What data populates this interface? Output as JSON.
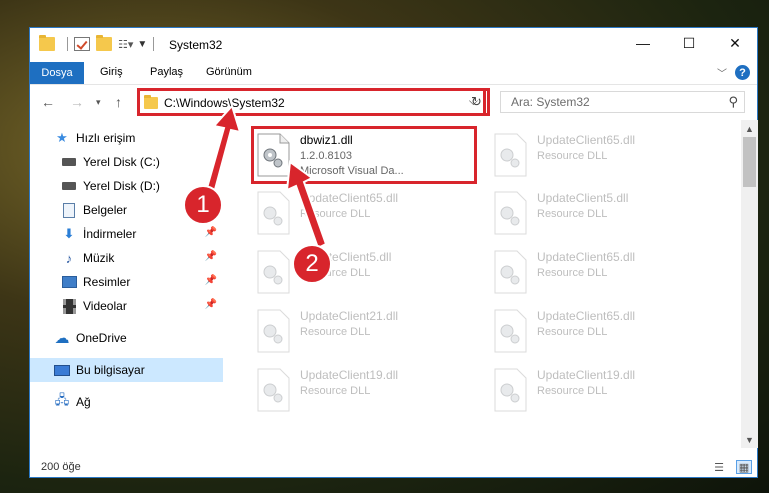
{
  "window": {
    "title": "System32",
    "minimize_icon": "minimize-icon",
    "maximize_icon": "maximize-icon",
    "close_icon": "close-icon"
  },
  "ribbon": {
    "tabs": [
      {
        "label": "Dosya"
      },
      {
        "label": "Giriş"
      },
      {
        "label": "Paylaş"
      },
      {
        "label": "Görünüm"
      }
    ],
    "help": "?"
  },
  "address": {
    "path": "C:\\Windows\\System32",
    "search_placeholder": "Ara: System32"
  },
  "sidebar": {
    "items": [
      {
        "label": "Hızlı erişim",
        "icon": "star-icon"
      },
      {
        "label": "Yerel Disk (C:)",
        "icon": "drive-icon"
      },
      {
        "label": "Yerel Disk (D:)",
        "icon": "drive-icon"
      },
      {
        "label": "Belgeler",
        "icon": "documents-icon"
      },
      {
        "label": "İndirmeler",
        "icon": "downloads-icon"
      },
      {
        "label": "Müzik",
        "icon": "music-icon"
      },
      {
        "label": "Resimler",
        "icon": "pictures-icon"
      },
      {
        "label": "Videolar",
        "icon": "videos-icon"
      },
      {
        "label": "OneDrive",
        "icon": "cloud-icon"
      },
      {
        "label": "Bu bilgisayar",
        "icon": "computer-icon"
      },
      {
        "label": "Ağ",
        "icon": "network-icon"
      }
    ]
  },
  "files": [
    {
      "name": "dbwiz1.dll",
      "version": "1.2.0.8103",
      "description": "Microsoft Visual Da..."
    },
    {
      "name": "UpdateClient65.dll",
      "version": "Resource DLL"
    },
    {
      "name": "UpdateClient65.dll",
      "version": "Resource DLL"
    },
    {
      "name": "UpdateClient5.dll",
      "version": "Resource DLL"
    },
    {
      "name": "UpdateClient5.dll",
      "version": "Resource DLL"
    },
    {
      "name": "UpdateClient65.dll",
      "version": "Resource DLL"
    },
    {
      "name": "UpdateClient21.dll",
      "version": "Resource DLL"
    },
    {
      "name": "UpdateClient65.dll",
      "version": "Resource DLL"
    },
    {
      "name": "UpdateClient19.dll",
      "version": "Resource DLL"
    },
    {
      "name": "UpdateClient19.dll",
      "version": "Resource DLL"
    }
  ],
  "status": {
    "count": "200 öğe"
  },
  "callouts": {
    "one": "1",
    "two": "2"
  },
  "colors": {
    "accent": "#1e6fc1",
    "highlight": "#d8252c",
    "selected": "#cce8ff"
  }
}
